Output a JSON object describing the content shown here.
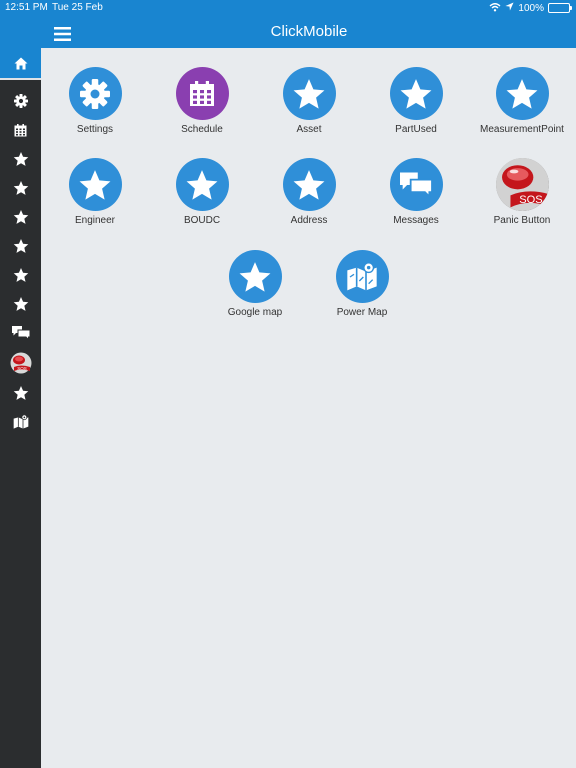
{
  "status_bar": {
    "time": "12:51 PM",
    "date": "Tue 25 Feb",
    "battery": "100%",
    "battery_level": 1.0
  },
  "header": {
    "title": "ClickMobile"
  },
  "sidebar": {
    "items": [
      {
        "icon": "home-icon"
      },
      {
        "icon": "gear-icon"
      },
      {
        "icon": "calendar-icon"
      },
      {
        "icon": "star-icon"
      },
      {
        "icon": "star-icon"
      },
      {
        "icon": "star-icon"
      },
      {
        "icon": "star-icon"
      },
      {
        "icon": "star-icon"
      },
      {
        "icon": "star-icon"
      },
      {
        "icon": "chat-bubbles-icon"
      },
      {
        "icon": "sos-button-icon"
      },
      {
        "icon": "star-icon"
      },
      {
        "icon": "map-icon"
      }
    ]
  },
  "tiles": [
    {
      "label": "Settings",
      "icon": "gear-icon"
    },
    {
      "label": "Schedule",
      "icon": "calendar-icon"
    },
    {
      "label": "Asset",
      "icon": "star-icon"
    },
    {
      "label": "PartUsed",
      "icon": "star-icon"
    },
    {
      "label": "MeasurementPoint",
      "icon": "star-icon"
    },
    {
      "label": "Engineer",
      "icon": "star-icon"
    },
    {
      "label": "BOUDC",
      "icon": "star-icon"
    },
    {
      "label": "Address",
      "icon": "star-icon"
    },
    {
      "label": "Messages",
      "icon": "chat-bubbles-icon"
    },
    {
      "label": "Panic Button",
      "icon": "sos-button-icon"
    },
    {
      "label": "Google map",
      "icon": "star-icon"
    },
    {
      "label": "Power Map",
      "icon": "map-icon"
    }
  ],
  "colors": {
    "accent": "#1985d0",
    "tile_blue": "#2f8fd8",
    "tile_purple": "#8a3fb0",
    "sidebar_bg": "#2b2d2f",
    "content_bg": "#e8ebee"
  }
}
